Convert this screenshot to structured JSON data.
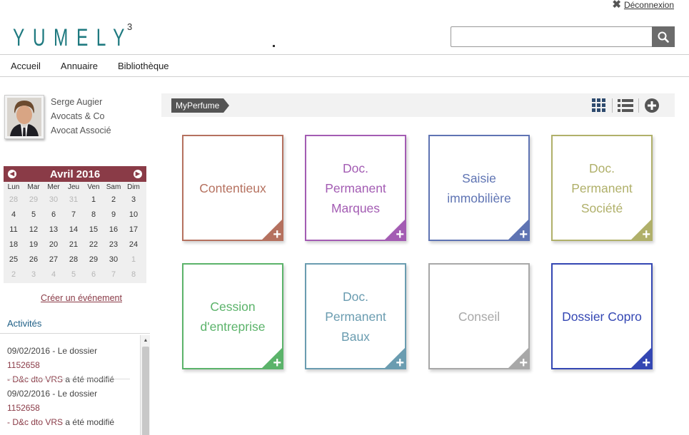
{
  "header": {
    "logout_label": "Déconnexion",
    "logo_text": "YUMELY",
    "logo_sup": "3",
    "search_placeholder": ""
  },
  "nav": {
    "items": [
      {
        "label": "Accueil"
      },
      {
        "label": "Annuaire"
      },
      {
        "label": "Bibliothèque"
      }
    ]
  },
  "profile": {
    "name": "Serge Augier",
    "company": "Avocats & Co",
    "role": "Avocat Associé"
  },
  "calendar": {
    "month_label": "Avril 2016",
    "day_names": [
      "Lun",
      "Mar",
      "Mer",
      "Jeu",
      "Ven",
      "Sam",
      "Dim"
    ],
    "weeks": [
      [
        {
          "d": "28",
          "m": true
        },
        {
          "d": "29",
          "m": true
        },
        {
          "d": "30",
          "m": true
        },
        {
          "d": "31",
          "m": true
        },
        {
          "d": "1",
          "m": false
        },
        {
          "d": "2",
          "m": false
        },
        {
          "d": "3",
          "m": false
        }
      ],
      [
        {
          "d": "4",
          "m": false
        },
        {
          "d": "5",
          "m": false
        },
        {
          "d": "6",
          "m": false
        },
        {
          "d": "7",
          "m": false
        },
        {
          "d": "8",
          "m": false
        },
        {
          "d": "9",
          "m": false
        },
        {
          "d": "10",
          "m": false
        }
      ],
      [
        {
          "d": "11",
          "m": false
        },
        {
          "d": "12",
          "m": false
        },
        {
          "d": "13",
          "m": false
        },
        {
          "d": "14",
          "m": false
        },
        {
          "d": "15",
          "m": false
        },
        {
          "d": "16",
          "m": false
        },
        {
          "d": "17",
          "m": false
        }
      ],
      [
        {
          "d": "18",
          "m": false
        },
        {
          "d": "19",
          "m": false
        },
        {
          "d": "20",
          "m": false
        },
        {
          "d": "21",
          "m": false
        },
        {
          "d": "22",
          "m": false
        },
        {
          "d": "23",
          "m": false
        },
        {
          "d": "24",
          "m": false
        }
      ],
      [
        {
          "d": "25",
          "m": false
        },
        {
          "d": "26",
          "m": false
        },
        {
          "d": "27",
          "m": false
        },
        {
          "d": "28",
          "m": false
        },
        {
          "d": "29",
          "m": false
        },
        {
          "d": "30",
          "m": false
        },
        {
          "d": "1",
          "m": true
        }
      ],
      [
        {
          "d": "2",
          "m": true
        },
        {
          "d": "3",
          "m": true
        },
        {
          "d": "4",
          "m": true
        },
        {
          "d": "5",
          "m": true
        },
        {
          "d": "6",
          "m": true
        },
        {
          "d": "7",
          "m": true
        },
        {
          "d": "8",
          "m": true
        }
      ]
    ],
    "create_event_label": "Créer un événement",
    "accent_color": "#8a3b47"
  },
  "activities": {
    "title": "Activités",
    "items": [
      {
        "date": "09/02/2016",
        "mid": " - Le dossier ",
        "ref": "1152658",
        "dash": "- ",
        "name": "D&c dto VRS",
        "suffix": " a été modifié"
      },
      {
        "date": "09/02/2016",
        "mid": " - Le dossier ",
        "ref": "1152658",
        "dash": "- ",
        "name": "D&c dto VRS",
        "suffix": " a été modifié"
      }
    ]
  },
  "toolbar": {
    "breadcrumb": "MyPerfume",
    "icons": [
      "grid-view-icon",
      "list-view-icon",
      "add-circle-icon"
    ]
  },
  "tiles": [
    {
      "line1": "Contentieux",
      "line2": "",
      "color": "#b5715f"
    },
    {
      "line1": "Doc. Permanent",
      "line2": "Marques",
      "color": "#a35cb3"
    },
    {
      "line1": "Saisie",
      "line2": "immobilière",
      "color": "#5f74b3"
    },
    {
      "line1": "Doc. Permanent",
      "line2": "Société",
      "color": "#b0b06a"
    },
    {
      "line1": "Cession",
      "line2": "d'entreprise",
      "color": "#5bb36a"
    },
    {
      "line1": "Doc. Permanent",
      "line2": "Baux",
      "color": "#6a9cb0"
    },
    {
      "line1": "Conseil",
      "line2": "",
      "color": "#a8a8a8"
    },
    {
      "line1": "Dossier Copro",
      "line2": "",
      "color": "#3447b3"
    }
  ]
}
